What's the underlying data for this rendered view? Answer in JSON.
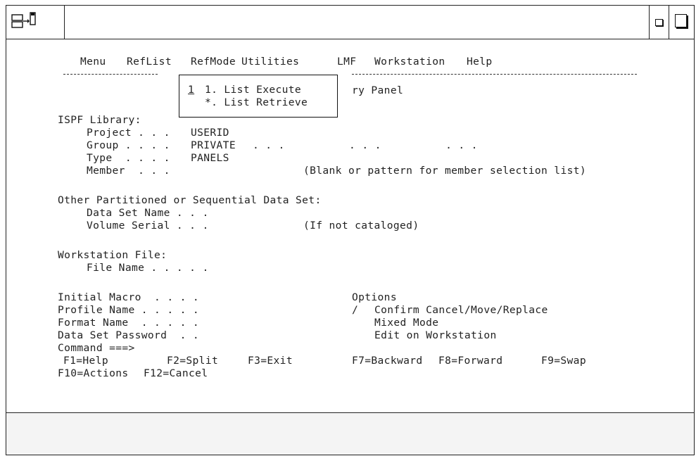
{
  "menubar": [
    "Menu",
    "RefList",
    "RefMode",
    "Utilities",
    "LMF",
    "Workstation",
    "Help"
  ],
  "popup": {
    "selected": "1",
    "item1": "1. List Execute",
    "item2": "*. List Retrieve"
  },
  "panel_title_fragment": "ry Panel",
  "isp_library": {
    "heading": "ISPF Library:",
    "project_label": "Project . . .",
    "project_value": "USERID",
    "group_label": "Group . . . .",
    "group_value": "PRIVATE",
    "group_dots": ". . .          . . .          . . .",
    "type_label": "Type  . . . .",
    "type_value": "PANELS",
    "member_label": "Member  . . .",
    "member_hint": "(Blank or pattern for member selection list)"
  },
  "other_ds": {
    "heading": "Other Partitioned or Sequential Data Set:",
    "dsname_label": "Data Set Name . . .",
    "volume_label": "Volume Serial . . .",
    "volume_hint": "(If not cataloged)"
  },
  "workstation": {
    "heading": "Workstation File:",
    "file_label": "File Name . . . . ."
  },
  "fields": {
    "initial_macro": "Initial Macro  . . . .",
    "profile_name": "Profile Name . . . . .",
    "format_name": "Format Name  . . . . .",
    "ds_password": "Data Set Password  . ."
  },
  "options": {
    "heading": "Options",
    "mark": "/",
    "opt1": "Confirm Cancel/Move/Replace",
    "opt2": "Mixed Mode",
    "opt3": "Edit on Workstation"
  },
  "command_prompt": "Command ===>",
  "fkeys": {
    "f1": "F1=Help",
    "f2": "F2=Split",
    "f3": "F3=Exit",
    "f7": "F7=Backward",
    "f8": "F8=Forward",
    "f9": "F9=Swap",
    "f10": "F10=Actions",
    "f12": "F12=Cancel"
  }
}
